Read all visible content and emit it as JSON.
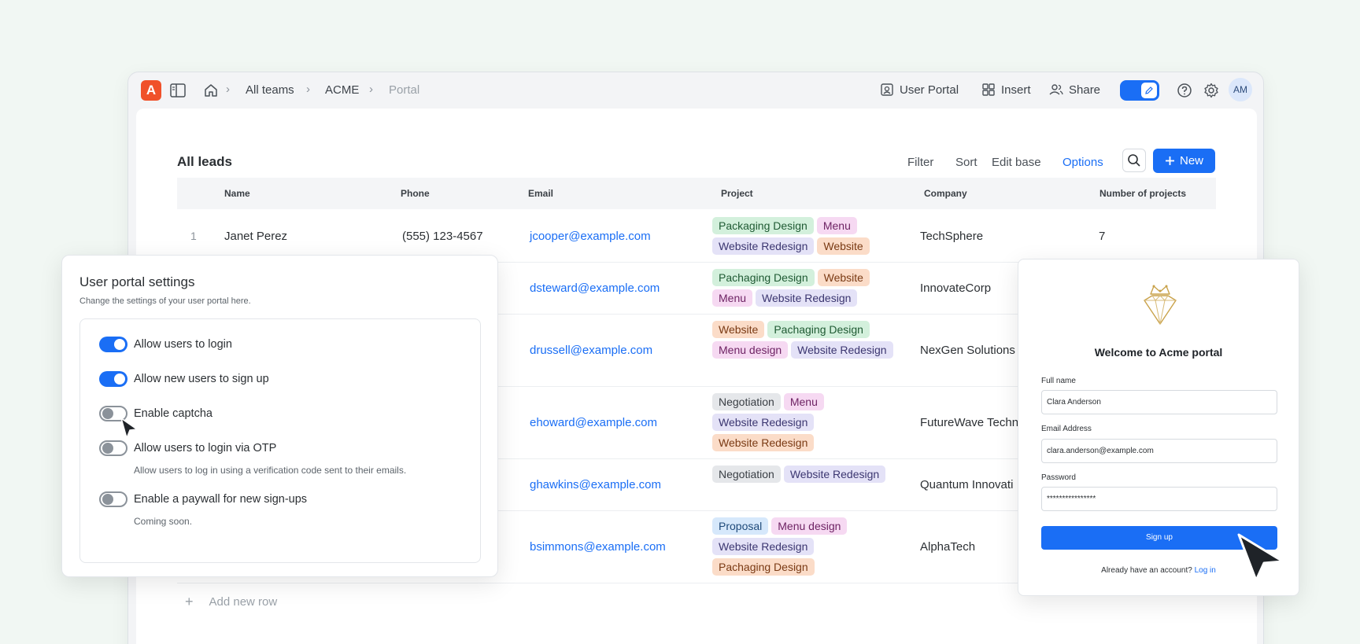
{
  "topbar": {
    "logo_letter": "A",
    "breadcrumbs": [
      "All teams",
      "ACME",
      "Portal"
    ],
    "actions": {
      "user_portal": "User Portal",
      "insert": "Insert",
      "share": "Share"
    },
    "avatar": "AM"
  },
  "toolbar": {
    "title": "All leads",
    "filter": "Filter",
    "sort": "Sort",
    "edit_base": "Edit base",
    "options": "Options",
    "new": "New"
  },
  "table": {
    "headers": [
      "Name",
      "Phone",
      "Email",
      "Project",
      "Company",
      "Number of projects"
    ],
    "rows": [
      {
        "num": "1",
        "name": "Janet Perez",
        "phone": "(555) 123-4567",
        "email": "jcooper@example.com",
        "company": "TechSphere",
        "projects": "7",
        "tags": [
          {
            "t": "Packaging Design",
            "c": "green"
          },
          {
            "t": "Menu",
            "c": "pink"
          },
          {
            "t": "Website Redesign",
            "c": "purple"
          },
          {
            "t": "Website",
            "c": "orange"
          }
        ]
      },
      {
        "num": "",
        "name": "",
        "phone": "",
        "email": "dsteward@example.com",
        "company": "InnovateCorp",
        "projects": "",
        "tags": [
          {
            "t": "Pachaging Design",
            "c": "green"
          },
          {
            "t": "Website",
            "c": "orange"
          },
          {
            "t": "Menu",
            "c": "pink"
          },
          {
            "t": "Website Redesign",
            "c": "purple"
          }
        ]
      },
      {
        "num": "",
        "name": "",
        "phone": "",
        "email": "drussell@example.com",
        "company": "NexGen Solutions",
        "projects": "",
        "tags": [
          {
            "t": "Website",
            "c": "orange"
          },
          {
            "t": "Pachaging Design",
            "c": "green"
          },
          {
            "t": "Menu design",
            "c": "pink"
          },
          {
            "t": "Website Redesign",
            "c": "purple"
          }
        ]
      },
      {
        "num": "",
        "name": "",
        "phone": "",
        "email": "ehoward@example.com",
        "company": "FutureWave Techn",
        "projects": "",
        "tags": [
          {
            "t": "Negotiation",
            "c": "gray"
          },
          {
            "t": "Menu",
            "c": "pink"
          },
          {
            "t": "Website Redesign",
            "c": "purple"
          },
          {
            "t": "Website Redesign",
            "c": "orange"
          }
        ]
      },
      {
        "num": "",
        "name": "",
        "phone": "",
        "email": "ghawkins@example.com",
        "company": "Quantum Innovati",
        "projects": "",
        "tags": [
          {
            "t": "Negotiation",
            "c": "gray"
          },
          {
            "t": "Website Redesign",
            "c": "purple"
          }
        ]
      },
      {
        "num": "",
        "name": "",
        "phone": "",
        "email": "bsimmons@example.com",
        "company": "AlphaTech",
        "projects": "",
        "tags": [
          {
            "t": "Proposal",
            "c": "blue"
          },
          {
            "t": "Menu design",
            "c": "pink"
          },
          {
            "t": "Website Redesign",
            "c": "purple"
          },
          {
            "t": "Pachaging Design",
            "c": "orange"
          }
        ]
      }
    ],
    "add_row": "Add new row"
  },
  "tag_colors": {
    "green": {
      "bg": "#d3f0dc",
      "fg": "#1f5a33"
    },
    "pink": {
      "bg": "#f6d9f2",
      "fg": "#6e2364"
    },
    "purple": {
      "bg": "#e4e2f7",
      "fg": "#3b3670"
    },
    "orange": {
      "bg": "#fbdcc8",
      "fg": "#7a3a14"
    },
    "gray": {
      "bg": "#e5e7ea",
      "fg": "#3a3f45"
    },
    "blue": {
      "bg": "#d6e8fb",
      "fg": "#1f4a7a"
    }
  },
  "settings": {
    "title": "User portal settings",
    "subtitle": "Change the settings of your user portal here.",
    "options": [
      {
        "label": "Allow users to login",
        "on": true,
        "desc": ""
      },
      {
        "label": "Allow new users to sign up",
        "on": true,
        "desc": ""
      },
      {
        "label": "Enable captcha",
        "on": false,
        "desc": ""
      },
      {
        "label": "Allow users to login via OTP",
        "on": false,
        "desc": "Allow users to log in using a verification code sent to their emails."
      },
      {
        "label": "Enable a paywall for new sign-ups",
        "on": false,
        "desc": "Coming soon."
      }
    ]
  },
  "login": {
    "title": "Welcome to Acme portal",
    "full_name_label": "Full name",
    "full_name_value": "Clara Anderson",
    "email_label": "Email Address",
    "email_value": "clara.anderson@example.com",
    "password_label": "Password",
    "password_value": "****************",
    "signup_button": "Sign up",
    "footer_text": "Already have an account?",
    "login_link": "Log in"
  }
}
